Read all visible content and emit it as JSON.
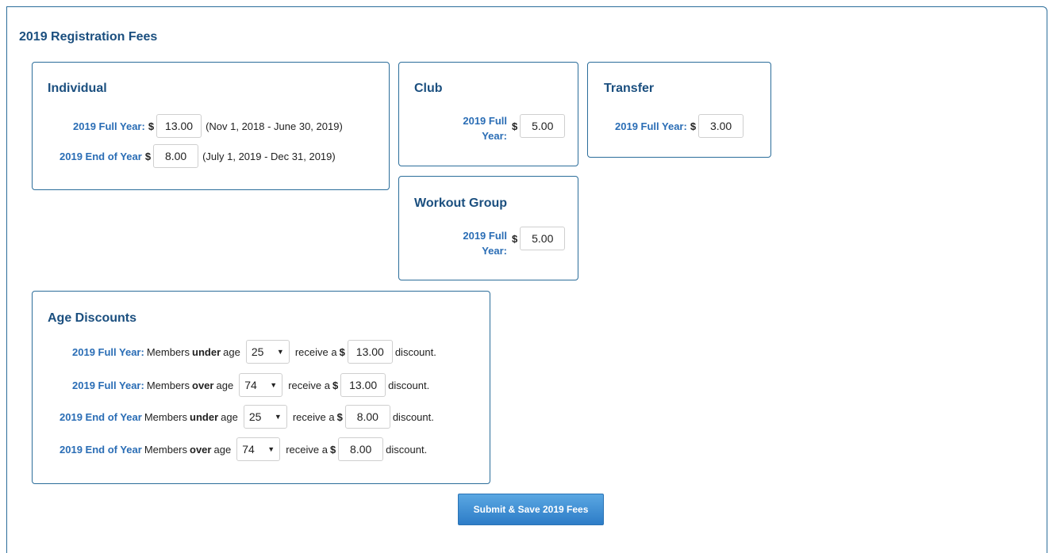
{
  "page_title": "2019 Registration Fees",
  "currency_symbol": "$",
  "individual": {
    "title": "Individual",
    "full_year_label": "2019 Full Year:",
    "full_year_value": "13.00",
    "full_year_note": "(Nov 1, 2018 - June 30, 2019)",
    "end_year_label": "2019 End of Year",
    "end_year_value": "8.00",
    "end_year_note": "(July 1, 2019 - Dec 31, 2019)"
  },
  "club": {
    "title": "Club",
    "label_line1": "2019 Full",
    "label_line2": "Year:",
    "value": "5.00"
  },
  "transfer": {
    "title": "Transfer",
    "label": "2019 Full Year:",
    "value": "3.00"
  },
  "workout_group": {
    "title": "Workout Group",
    "label_line1": "2019 Full",
    "label_line2": "Year:",
    "value": "5.00"
  },
  "age_discounts": {
    "title": "Age Discounts",
    "members_text": "Members",
    "age_text": "age",
    "receive_text": "receive a",
    "discount_text": "discount.",
    "rows": [
      {
        "label": "2019 Full Year:",
        "qualifier": "under",
        "age": "25",
        "amount": "13.00"
      },
      {
        "label": "2019 Full Year:",
        "qualifier": "over",
        "age": "74",
        "amount": "13.00"
      },
      {
        "label": "2019 End of Year",
        "qualifier": "under",
        "age": "25",
        "amount": "8.00"
      },
      {
        "label": "2019 End of Year",
        "qualifier": "over",
        "age": "74",
        "amount": "8.00"
      }
    ]
  },
  "submit_label": "Submit & Save 2019 Fees"
}
